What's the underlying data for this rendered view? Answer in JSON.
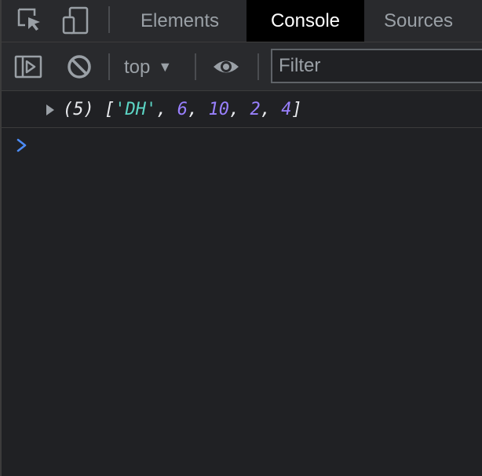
{
  "tabs": [
    {
      "label": "Elements",
      "active": false
    },
    {
      "label": "Console",
      "active": true
    },
    {
      "label": "Sources",
      "active": false
    }
  ],
  "toolbar_icons": {
    "inspect": "inspect-element-icon",
    "device": "device-toolbar-icon",
    "sidebar": "show-console-sidebar-icon",
    "clear": "clear-console-icon",
    "live_expression": "live-expression-eye-icon"
  },
  "console_toolbar": {
    "context": "top",
    "context_arrow": "▼",
    "filter_placeholder": "Filter"
  },
  "console_log": {
    "count": "(5)",
    "open_bracket": "[",
    "close_bracket": "]",
    "separator": ", ",
    "items": [
      {
        "text": "'DH'",
        "kind": "string"
      },
      {
        "text": "6",
        "kind": "number"
      },
      {
        "text": "10",
        "kind": "number"
      },
      {
        "text": "2",
        "kind": "number"
      },
      {
        "text": "4",
        "kind": "number"
      }
    ]
  },
  "colors": {
    "background": "#202124",
    "toolbar": "#292a2d",
    "string": "#5cd5c5",
    "number": "#9980ff",
    "prompt": "#4c8bf5",
    "active_tab": "#000000"
  }
}
